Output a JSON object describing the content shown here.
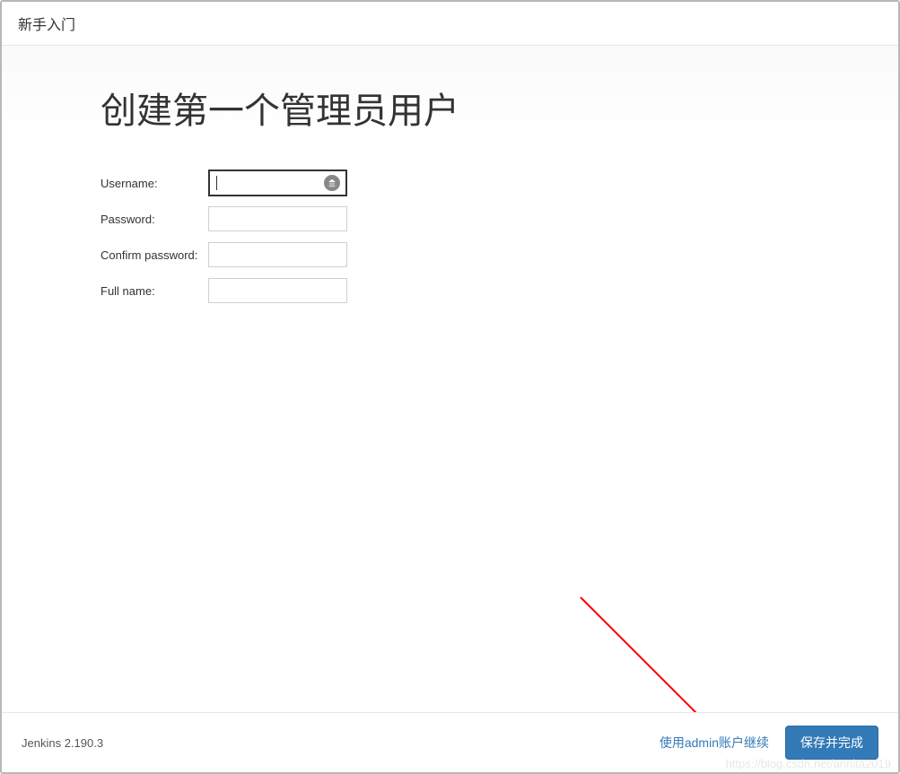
{
  "header": {
    "title": "新手入门"
  },
  "page": {
    "title": "创建第一个管理员用户"
  },
  "form": {
    "fields": [
      {
        "label": "Username:",
        "type": "text",
        "value": "",
        "focused": true,
        "has_icon": true
      },
      {
        "label": "Password:",
        "type": "password",
        "value": "",
        "focused": false,
        "has_icon": false
      },
      {
        "label": "Confirm password:",
        "type": "password",
        "value": "",
        "focused": false,
        "has_icon": false
      },
      {
        "label": "Full name:",
        "type": "text",
        "value": "",
        "focused": false,
        "has_icon": false
      }
    ]
  },
  "footer": {
    "version": "Jenkins 2.190.3",
    "continue_as_admin": "使用admin账户继续",
    "save_and_finish": "保存并完成"
  },
  "watermark": "https://blog.csdn.net/annita2019"
}
